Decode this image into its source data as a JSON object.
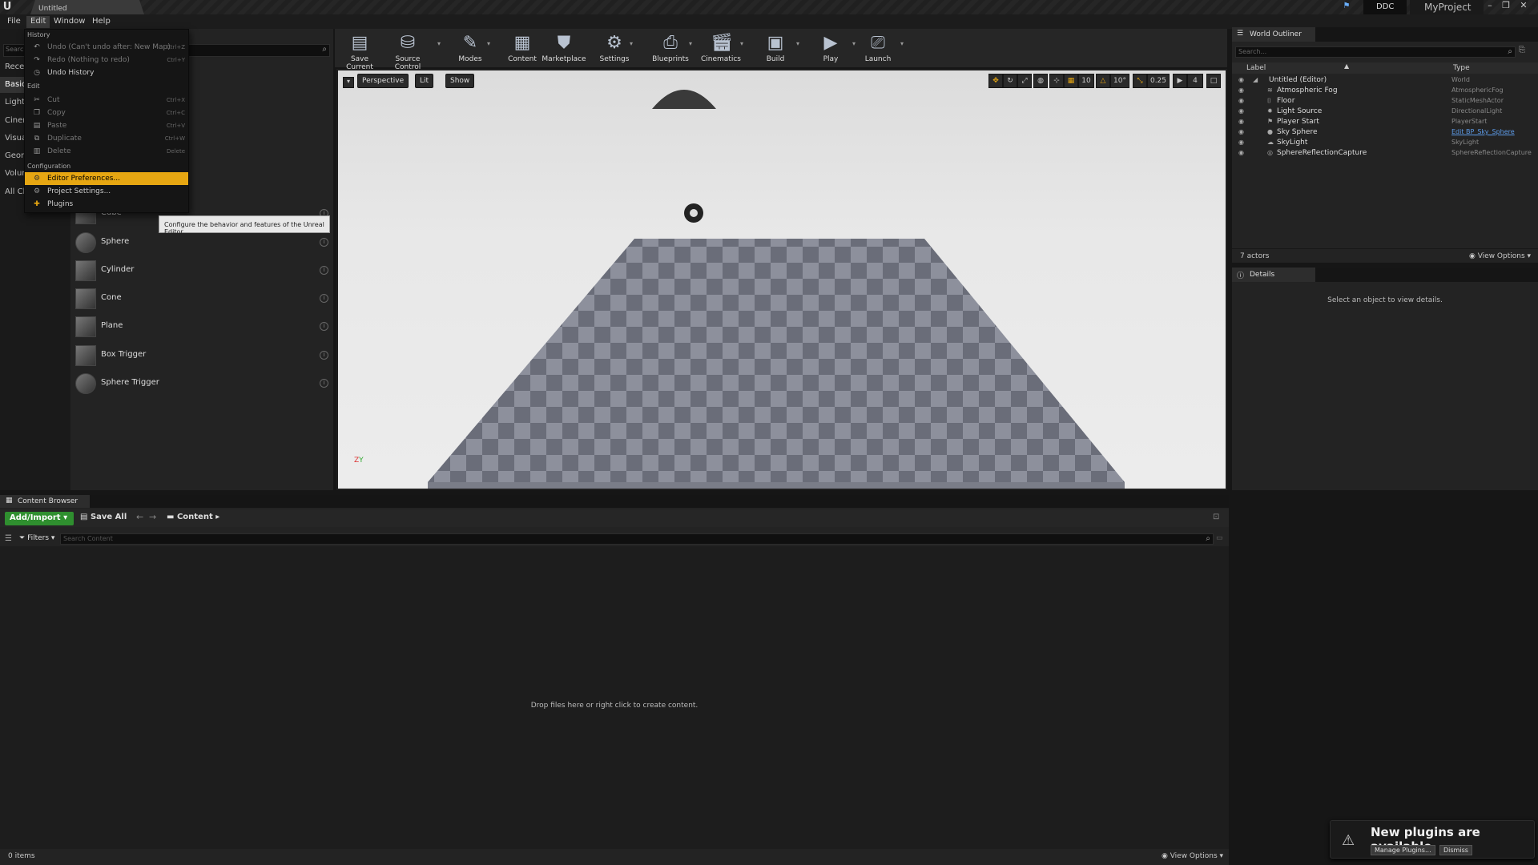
{
  "window": {
    "doc_tab": "Untitled",
    "ddc_label": "DDC",
    "project": "MyProject"
  },
  "menubar": [
    "File",
    "Edit",
    "Window",
    "Help"
  ],
  "left_panel": {
    "search_placeholder": "Search",
    "categories": [
      "Recent",
      "Basic",
      "Lights",
      "Cinematic",
      "Visual",
      "Geometry",
      "Volumes",
      "All Classes"
    ],
    "items": [
      "Cube",
      "Sphere",
      "Cylinder",
      "Cone",
      "Plane",
      "Box Trigger",
      "Sphere Trigger"
    ]
  },
  "edit_menu": {
    "history_section": "History",
    "undo": {
      "label": "Undo (Can't undo after: New Map)",
      "shortcut": "Ctrl+Z"
    },
    "redo": {
      "label": "Redo (Nothing to redo)",
      "shortcut": "Ctrl+Y"
    },
    "undo_history": "Undo History",
    "edit_section": "Edit",
    "cut": {
      "label": "Cut",
      "shortcut": "Ctrl+X"
    },
    "copy": {
      "label": "Copy",
      "shortcut": "Ctrl+C"
    },
    "paste": {
      "label": "Paste",
      "shortcut": "Ctrl+V"
    },
    "duplicate": {
      "label": "Duplicate",
      "shortcut": "Ctrl+W"
    },
    "delete": {
      "label": "Delete",
      "shortcut": "Delete"
    },
    "config_section": "Configuration",
    "editor_prefs": "Editor Preferences...",
    "project_settings": "Project Settings...",
    "plugins": "Plugins"
  },
  "tooltip": "Configure the behavior and features of the Unreal Editor.",
  "toolbar": [
    "Save Current",
    "Source Control",
    "Modes",
    "Content",
    "Marketplace",
    "Settings",
    "Blueprints",
    "Cinematics",
    "Build",
    "Play",
    "Launch"
  ],
  "viewport": {
    "perspective": "Perspective",
    "lit": "Lit",
    "show": "Show",
    "grid_snap": "10",
    "rot_snap": "10°",
    "scale_snap": "0.25",
    "camera_speed": "4"
  },
  "outliner": {
    "tab": "World Outliner",
    "search_placeholder": "Search...",
    "col_label": "Label",
    "col_type": "Type",
    "rows": [
      {
        "label": "Untitled (Editor)",
        "type": "World"
      },
      {
        "label": "Atmospheric Fog",
        "type": "AtmosphericFog"
      },
      {
        "label": "Floor",
        "type": "StaticMeshActor"
      },
      {
        "label": "Light Source",
        "type": "DirectionalLight"
      },
      {
        "label": "Player Start",
        "type": "PlayerStart"
      },
      {
        "label": "Sky Sphere",
        "type": "Edit BP_Sky_Sphere"
      },
      {
        "label": "SkyLight",
        "type": "SkyLight"
      },
      {
        "label": "SphereReflectionCapture",
        "type": "SphereReflectionCapture"
      }
    ],
    "actor_count": "7 actors",
    "view_options": "View Options"
  },
  "details": {
    "tab": "Details",
    "empty": "Select an object to view details."
  },
  "content_browser": {
    "tab": "Content Browser",
    "add_import": "Add/Import",
    "save_all": "Save All",
    "path": "Content",
    "filters": "Filters",
    "search_placeholder": "Search Content",
    "empty": "Drop files here or right click to create content.",
    "items_count": "0 items",
    "view_options": "View Options"
  },
  "notification": {
    "title": "New plugins are available",
    "manage": "Manage Plugins...",
    "dismiss": "Dismiss"
  },
  "colors": {
    "accent": "#e6a612",
    "add_import": "#2f8f2f",
    "link": "#5d9be8"
  }
}
